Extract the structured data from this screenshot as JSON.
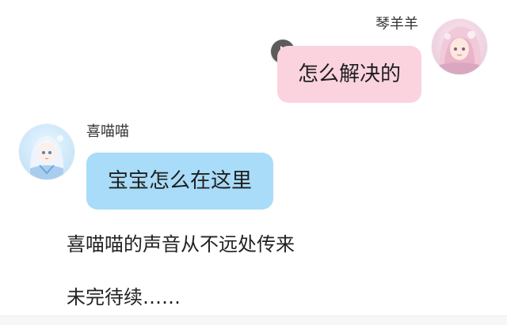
{
  "chat": {
    "messages": [
      {
        "sender": "琴羊羊",
        "text": "怎么解决的",
        "side": "right",
        "bubble_color": "#fad3df",
        "avatar_icon": "pink-haired-girl-avatar-icon",
        "has_voice_button": true
      },
      {
        "sender": "喜喵喵",
        "text": "宝宝怎么在这里",
        "side": "left",
        "bubble_color": "#a9dcf9",
        "avatar_icon": "white-haired-boy-avatar-icon",
        "has_voice_button": false
      }
    ],
    "narration": [
      "喜喵喵的声音从不远处传来",
      "未完待续……"
    ]
  },
  "colors": {
    "right_bubble": "#fad3df",
    "left_bubble": "#a9dcf9",
    "play_button": "#5c5c5c"
  }
}
